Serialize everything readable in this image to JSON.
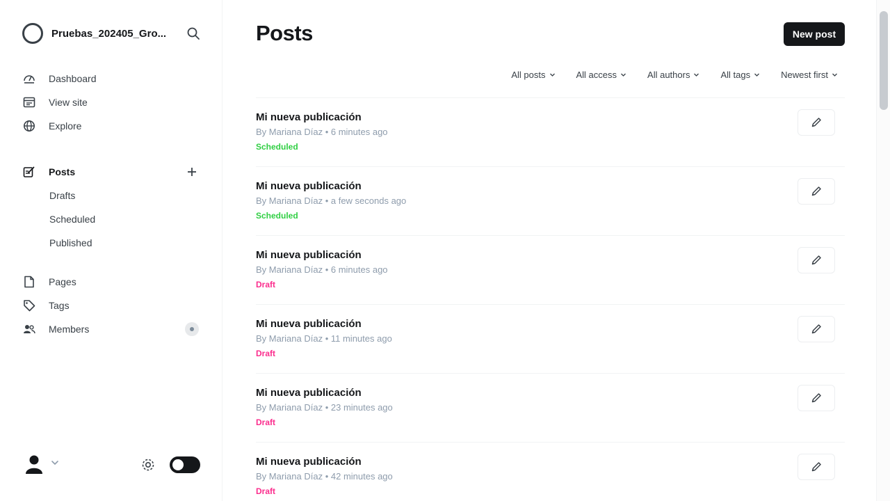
{
  "sidebar": {
    "site_title": "Pruebas_202405_Gro...",
    "top_nav": [
      {
        "label": "Dashboard",
        "icon": "dashboard-icon"
      },
      {
        "label": "View site",
        "icon": "browser-icon"
      },
      {
        "label": "Explore",
        "icon": "globe-icon"
      }
    ],
    "posts": {
      "label": "Posts",
      "icon": "posts-icon",
      "plus_icon": "plus-icon",
      "subitems": [
        {
          "label": "Drafts"
        },
        {
          "label": "Scheduled"
        },
        {
          "label": "Published"
        }
      ]
    },
    "bottom_nav": [
      {
        "label": "Pages",
        "icon": "page-icon"
      },
      {
        "label": "Tags",
        "icon": "tag-icon"
      },
      {
        "label": "Members",
        "icon": "members-icon"
      }
    ]
  },
  "header": {
    "title": "Posts",
    "new_post_label": "New post"
  },
  "filters": [
    {
      "label": "All posts"
    },
    {
      "label": "All access"
    },
    {
      "label": "All authors"
    },
    {
      "label": "All tags"
    },
    {
      "label": "Newest first"
    }
  ],
  "posts": [
    {
      "title": "Mi nueva publicación",
      "meta": "By Mariana Díaz • 6 minutes ago",
      "status": "Scheduled"
    },
    {
      "title": "Mi nueva publicación",
      "meta": "By Mariana Díaz • a few seconds ago",
      "status": "Scheduled"
    },
    {
      "title": "Mi nueva publicación",
      "meta": "By Mariana Díaz • 6 minutes ago",
      "status": "Draft"
    },
    {
      "title": "Mi nueva publicación",
      "meta": "By Mariana Díaz • 11 minutes ago",
      "status": "Draft"
    },
    {
      "title": "Mi nueva publicación",
      "meta": "By Mariana Díaz • 23 minutes ago",
      "status": "Draft"
    },
    {
      "title": "Mi nueva publicación",
      "meta": "By Mariana Díaz • 42 minutes ago",
      "status": "Draft"
    }
  ],
  "colors": {
    "scheduled": "#30cf43",
    "draft": "#fb2d8d",
    "primary_button": "#15171a"
  }
}
